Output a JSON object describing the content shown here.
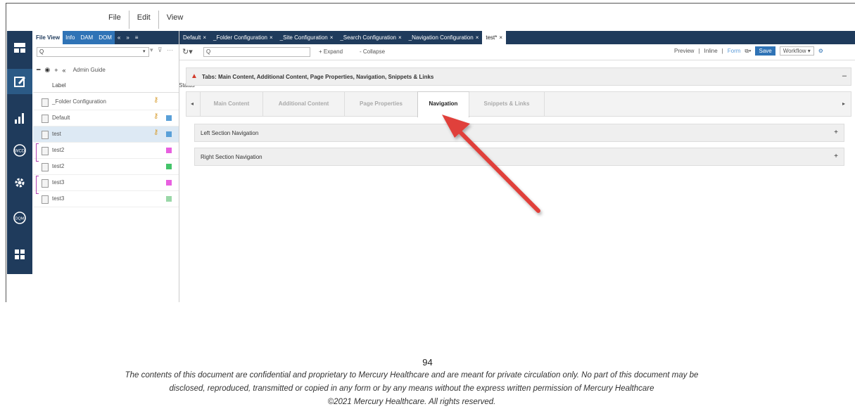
{
  "menu": [
    "File",
    "Edit",
    "View"
  ],
  "left_panel": {
    "tabs": [
      "File View",
      "Info",
      "DAM",
      "DOM"
    ],
    "tab_nav": [
      "«",
      "»",
      "≡"
    ],
    "search_placeholder": "Q",
    "toolbar_guide": "Admin Guide",
    "col_label": "Label",
    "col_status": "Status",
    "rows": [
      {
        "name": "_Folder Configuration",
        "key": true,
        "color": null
      },
      {
        "name": "Default",
        "key": true,
        "color": "#5aa0d8"
      },
      {
        "name": "test",
        "key": true,
        "color": "#5aa0d8"
      },
      {
        "name": "test2",
        "key": false,
        "color": "#e860e0"
      },
      {
        "name": "test2",
        "key": false,
        "color": "#44c46a"
      },
      {
        "name": "test3",
        "key": false,
        "color": "#e860e0"
      },
      {
        "name": "test3",
        "key": false,
        "color": "#9ad8a8"
      }
    ]
  },
  "doc_tabs": [
    "Default",
    "_Folder Configuration",
    "_Site Configuration",
    "_Search Configuration",
    "_Navigation Configuration",
    "test*"
  ],
  "toolbar": {
    "search": "Q",
    "expand": "+ Expand",
    "collapse": "- Collapse",
    "preview": "Preview",
    "inline": "Inline",
    "form": "Form",
    "save": "Save",
    "workflow": "Workflow ▾"
  },
  "main": {
    "warning": "Tabs: Main Content, Additional Content, Page Properties, Navigation, Snippets & Links",
    "section_tabs": [
      "Main Content",
      "Additional Content",
      "Page Properties",
      "Navigation",
      "Snippets & Links"
    ],
    "active_tab": "Navigation",
    "sections": [
      "Left Section Navigation",
      "Right Section Navigation"
    ]
  },
  "footer": {
    "page_number": "94",
    "line1": "The contents of this document are confidential and proprietary to Mercury Healthcare and are meant for private circulation only.  No part of this document may be",
    "line2": "disclosed, reproduced, transmitted or copied in any form or by any means without the express written permission of Mercury Healthcare",
    "line3": "©2021 Mercury Healthcare.  All rights reserved."
  },
  "colors": {
    "navy": "#1f3b5c",
    "accent": "#2f73b6",
    "arrow": "#e0403a"
  }
}
